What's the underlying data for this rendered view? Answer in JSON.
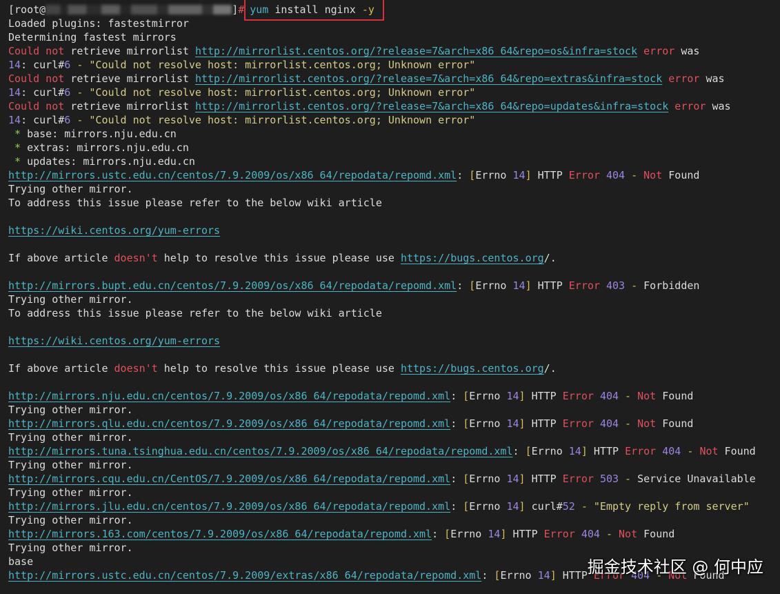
{
  "prompt": {
    "open": "[root@",
    "close": "]",
    "hash": "#",
    "cmd_yum": "yum",
    "cmd_rest": " install nginx ",
    "cmd_flag": "-y"
  },
  "lines": [
    [
      [
        "Loaded plugins: fastestmirror",
        "w"
      ]
    ],
    [
      [
        "Determining fastest mirrors",
        "w"
      ]
    ],
    [
      [
        "Could not",
        "r"
      ],
      [
        " retrieve mirrorlist ",
        "w"
      ],
      [
        "http://mirrorlist.centos.org/?release=7&arch=x86_64&repo=os&infra=stock",
        "u"
      ],
      [
        " error",
        "r"
      ],
      [
        " was",
        "w"
      ]
    ],
    [
      [
        "14",
        "p"
      ],
      [
        ": curl#",
        "w"
      ],
      [
        "6",
        "p"
      ],
      [
        " - ",
        "y"
      ],
      [
        "\"Could not resolve host: mirrorlist.centos.org; Unknown error\"",
        "s"
      ]
    ],
    [
      [
        "Could not",
        "r"
      ],
      [
        " retrieve mirrorlist ",
        "w"
      ],
      [
        "http://mirrorlist.centos.org/?release=7&arch=x86_64&repo=extras&infra=stock",
        "u"
      ],
      [
        " error",
        "r"
      ],
      [
        " was",
        "w"
      ]
    ],
    [
      [
        "14",
        "p"
      ],
      [
        ": curl#",
        "w"
      ],
      [
        "6",
        "p"
      ],
      [
        " - ",
        "y"
      ],
      [
        "\"Could not resolve host: mirrorlist.centos.org; Unknown error\"",
        "s"
      ]
    ],
    [
      [
        "Could not",
        "r"
      ],
      [
        " retrieve mirrorlist ",
        "w"
      ],
      [
        "http://mirrorlist.centos.org/?release=7&arch=x86_64&repo=updates&infra=stock",
        "u"
      ],
      [
        " error",
        "r"
      ],
      [
        " was",
        "w"
      ]
    ],
    [
      [
        "14",
        "p"
      ],
      [
        ": curl#",
        "w"
      ],
      [
        "6",
        "p"
      ],
      [
        " - ",
        "y"
      ],
      [
        "\"Could not resolve host: mirrorlist.centos.org; Unknown error\"",
        "s"
      ]
    ],
    [
      [
        " * ",
        "g"
      ],
      [
        "base: mirrors.nju.edu.cn",
        "w"
      ]
    ],
    [
      [
        " * ",
        "g"
      ],
      [
        "extras: mirrors.nju.edu.cn",
        "w"
      ]
    ],
    [
      [
        " * ",
        "g"
      ],
      [
        "updates: mirrors.nju.edu.cn",
        "w"
      ]
    ],
    [
      [
        "http://mirrors.ustc.edu.cn/centos/7.9.2009/os/x86_64/repodata/repomd.xml",
        "u"
      ],
      [
        ": ",
        "w"
      ],
      [
        "[",
        "y"
      ],
      [
        "Errno ",
        "w"
      ],
      [
        "14",
        "p"
      ],
      [
        "]",
        "y"
      ],
      [
        " HTTP ",
        "w"
      ],
      [
        "Error ",
        "r"
      ],
      [
        "404",
        "p"
      ],
      [
        " - ",
        "y"
      ],
      [
        "Not",
        "r"
      ],
      [
        " Found",
        "w"
      ]
    ],
    [
      [
        "Trying other mirror.",
        "w"
      ]
    ],
    [
      [
        "To address this issue please refer to the below wiki article",
        "w"
      ]
    ],
    [],
    [
      [
        "https://wiki.centos.org/yum-errors",
        "u"
      ]
    ],
    [],
    [
      [
        "If above article ",
        "w"
      ],
      [
        "doesn't",
        "r"
      ],
      [
        " help to resolve this issue please use ",
        "w"
      ],
      [
        "https://bugs.centos.org",
        "u"
      ],
      [
        "/.",
        "w"
      ]
    ],
    [],
    [
      [
        "http://mirrors.bupt.edu.cn/centos/7.9.2009/os/x86_64/repodata/repomd.xml",
        "u"
      ],
      [
        ": ",
        "w"
      ],
      [
        "[",
        "y"
      ],
      [
        "Errno ",
        "w"
      ],
      [
        "14",
        "p"
      ],
      [
        "]",
        "y"
      ],
      [
        " HTTP ",
        "w"
      ],
      [
        "Error ",
        "r"
      ],
      [
        "403",
        "p"
      ],
      [
        " - ",
        "y"
      ],
      [
        "Forbidden",
        "w"
      ]
    ],
    [
      [
        "Trying other mirror.",
        "w"
      ]
    ],
    [
      [
        "To address this issue please refer to the below wiki article",
        "w"
      ]
    ],
    [],
    [
      [
        "https://wiki.centos.org/yum-errors",
        "u"
      ]
    ],
    [],
    [
      [
        "If above article ",
        "w"
      ],
      [
        "doesn't",
        "r"
      ],
      [
        " help to resolve this issue please use ",
        "w"
      ],
      [
        "https://bugs.centos.org",
        "u"
      ],
      [
        "/.",
        "w"
      ]
    ],
    [],
    [
      [
        "http://mirrors.nju.edu.cn/centos/7.9.2009/os/x86_64/repodata/repomd.xml",
        "u"
      ],
      [
        ": ",
        "w"
      ],
      [
        "[",
        "y"
      ],
      [
        "Errno ",
        "w"
      ],
      [
        "14",
        "p"
      ],
      [
        "]",
        "y"
      ],
      [
        " HTTP ",
        "w"
      ],
      [
        "Error ",
        "r"
      ],
      [
        "404",
        "p"
      ],
      [
        " - ",
        "y"
      ],
      [
        "Not",
        "r"
      ],
      [
        " Found",
        "w"
      ]
    ],
    [
      [
        "Trying other mirror.",
        "w"
      ]
    ],
    [
      [
        "http://mirrors.qlu.edu.cn/centos/7.9.2009/os/x86_64/repodata/repomd.xml",
        "u"
      ],
      [
        ": ",
        "w"
      ],
      [
        "[",
        "y"
      ],
      [
        "Errno ",
        "w"
      ],
      [
        "14",
        "p"
      ],
      [
        "]",
        "y"
      ],
      [
        " HTTP ",
        "w"
      ],
      [
        "Error ",
        "r"
      ],
      [
        "404",
        "p"
      ],
      [
        " - ",
        "y"
      ],
      [
        "Not",
        "r"
      ],
      [
        " Found",
        "w"
      ]
    ],
    [
      [
        "Trying other mirror.",
        "w"
      ]
    ],
    [
      [
        "http://mirrors.tuna.tsinghua.edu.cn/centos/7.9.2009/os/x86_64/repodata/repomd.xml",
        "u"
      ],
      [
        ": ",
        "w"
      ],
      [
        "[",
        "y"
      ],
      [
        "Errno ",
        "w"
      ],
      [
        "14",
        "p"
      ],
      [
        "]",
        "y"
      ],
      [
        " HTTP ",
        "w"
      ],
      [
        "Error ",
        "r"
      ],
      [
        "404",
        "p"
      ],
      [
        " - ",
        "y"
      ],
      [
        "Not",
        "r"
      ],
      [
        " Found",
        "w"
      ]
    ],
    [
      [
        "Trying other mirror.",
        "w"
      ]
    ],
    [
      [
        "http://mirrors.cqu.edu.cn/CentOS/7.9.2009/os/x86_64/repodata/repomd.xml",
        "u"
      ],
      [
        ": ",
        "w"
      ],
      [
        "[",
        "y"
      ],
      [
        "Errno ",
        "w"
      ],
      [
        "14",
        "p"
      ],
      [
        "]",
        "y"
      ],
      [
        " HTTP ",
        "w"
      ],
      [
        "Error ",
        "r"
      ],
      [
        "503",
        "p"
      ],
      [
        " - ",
        "y"
      ],
      [
        "Service Unavailable",
        "w"
      ]
    ],
    [
      [
        "Trying other mirror.",
        "w"
      ]
    ],
    [
      [
        "http://mirrors.jlu.edu.cn/centos/7.9.2009/os/x86_64/repodata/repomd.xml",
        "u"
      ],
      [
        ": ",
        "w"
      ],
      [
        "[",
        "y"
      ],
      [
        "Errno ",
        "w"
      ],
      [
        "14",
        "p"
      ],
      [
        "]",
        "y"
      ],
      [
        " curl#",
        "w"
      ],
      [
        "52",
        "p"
      ],
      [
        " - ",
        "y"
      ],
      [
        "\"Empty reply from server\"",
        "s"
      ]
    ],
    [
      [
        "Trying other mirror.",
        "w"
      ]
    ],
    [
      [
        "http://mirrors.163.com/centos/7.9.2009/os/x86_64/repodata/repomd.xml",
        "u"
      ],
      [
        ": ",
        "w"
      ],
      [
        "[",
        "y"
      ],
      [
        "Errno ",
        "w"
      ],
      [
        "14",
        "p"
      ],
      [
        "]",
        "y"
      ],
      [
        " HTTP ",
        "w"
      ],
      [
        "Error ",
        "r"
      ],
      [
        "404",
        "p"
      ],
      [
        " - ",
        "y"
      ],
      [
        "Not",
        "r"
      ],
      [
        " Found",
        "w"
      ]
    ],
    [
      [
        "Trying other mirror.",
        "w"
      ]
    ],
    [
      [
        "base",
        "w"
      ]
    ],
    [
      [
        "http://mirrors.ustc.edu.cn/centos/7.9.2009/extras/x86_64/repodata/repomd.xml",
        "u"
      ],
      [
        ": ",
        "w"
      ],
      [
        "[",
        "y"
      ],
      [
        "Errno ",
        "w"
      ],
      [
        "14",
        "p"
      ],
      [
        "]",
        "y"
      ],
      [
        " HTTP ",
        "w"
      ],
      [
        "Error ",
        "r"
      ],
      [
        "404",
        "p"
      ],
      [
        " - ",
        "y"
      ],
      [
        "Not",
        "r"
      ],
      [
        " Found",
        "w"
      ]
    ]
  ],
  "watermark": "掘金技术社区 @ 何中应"
}
